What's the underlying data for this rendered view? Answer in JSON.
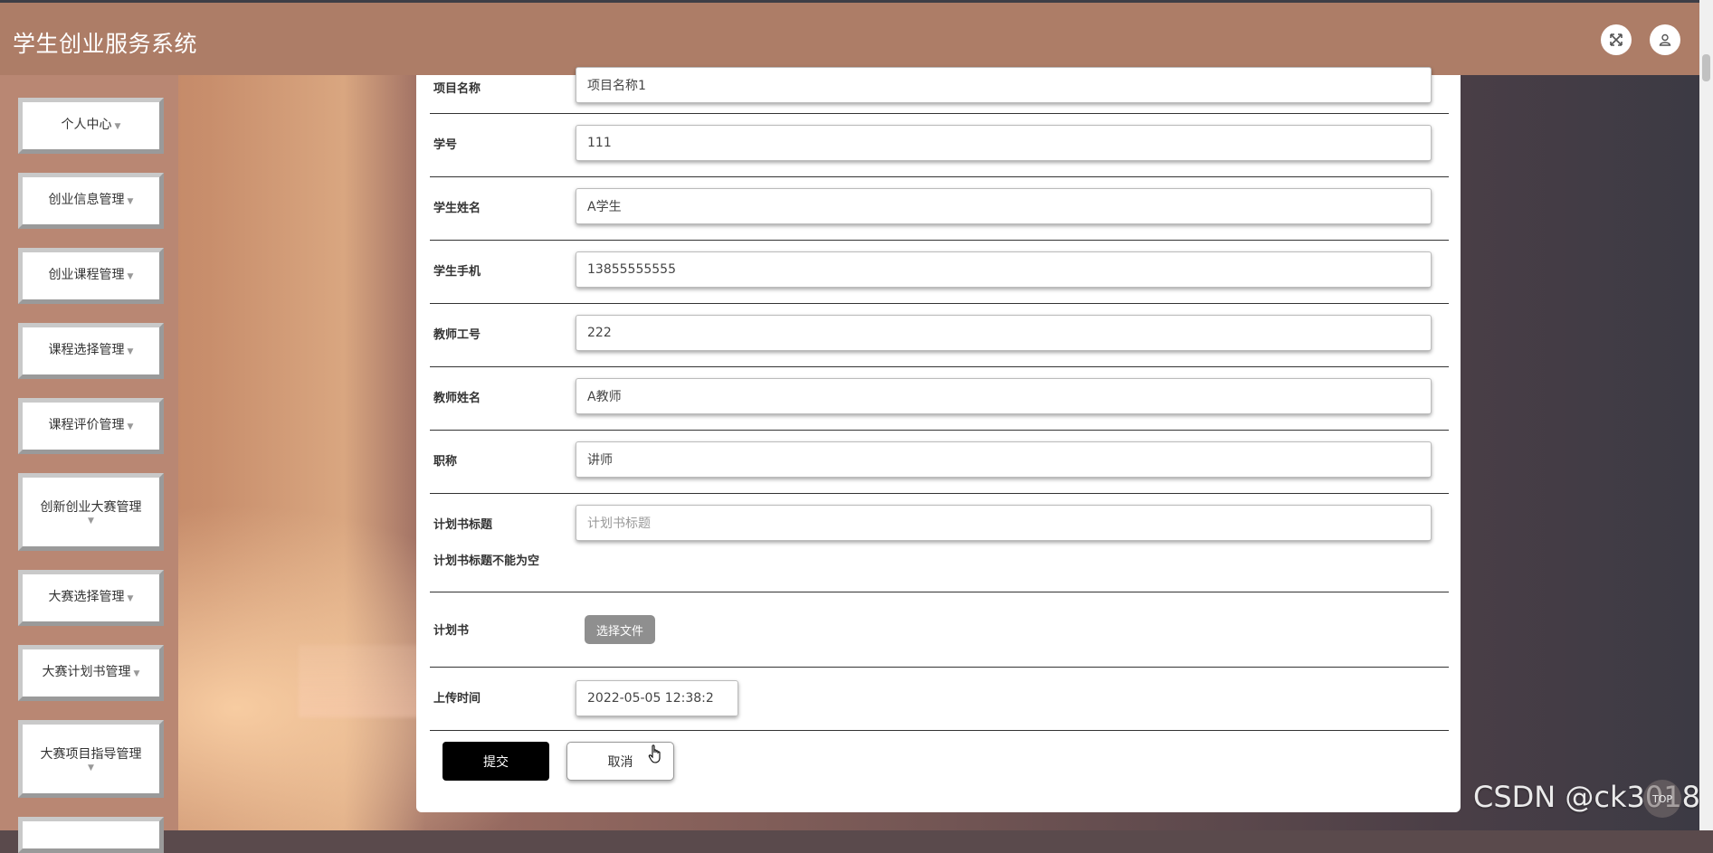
{
  "app": {
    "title": "学生创业服务系统"
  },
  "header_icons": {
    "fullscreen": "fullscreen-icon",
    "user": "user-icon"
  },
  "sidebar": {
    "items": [
      {
        "label": "个人中心"
      },
      {
        "label": "创业信息管理"
      },
      {
        "label": "创业课程管理"
      },
      {
        "label": "课程选择管理"
      },
      {
        "label": "课程评价管理"
      },
      {
        "label": "创新创业大赛管理"
      },
      {
        "label": "大赛选择管理"
      },
      {
        "label": "大赛计划书管理"
      },
      {
        "label": "大赛项目指导管理"
      }
    ]
  },
  "form": {
    "fields": [
      {
        "label": "项目名称",
        "value": "项目名称1"
      },
      {
        "label": "学号",
        "value": "111"
      },
      {
        "label": "学生姓名",
        "value": "A学生"
      },
      {
        "label": "学生手机",
        "value": "13855555555"
      },
      {
        "label": "教师工号",
        "value": "222"
      },
      {
        "label": "教师姓名",
        "value": "A教师"
      },
      {
        "label": "职称",
        "value": "讲师"
      }
    ],
    "plan_title": {
      "label": "计划书标题",
      "placeholder": "计划书标题",
      "error": "计划书标题不能为空"
    },
    "plan_file": {
      "label": "计划书",
      "button": "选择文件"
    },
    "upload_time": {
      "label": "上传时间",
      "value": "2022-05-05 12:38:2"
    },
    "submit_label": "提交",
    "cancel_label": "取消"
  },
  "overlay": {
    "watermark": "CSDN @ck3018",
    "back_to_top": "TOP"
  },
  "colors": {
    "header": "#ad7d67",
    "sidebar": "#b98773",
    "submit": "#000000"
  }
}
